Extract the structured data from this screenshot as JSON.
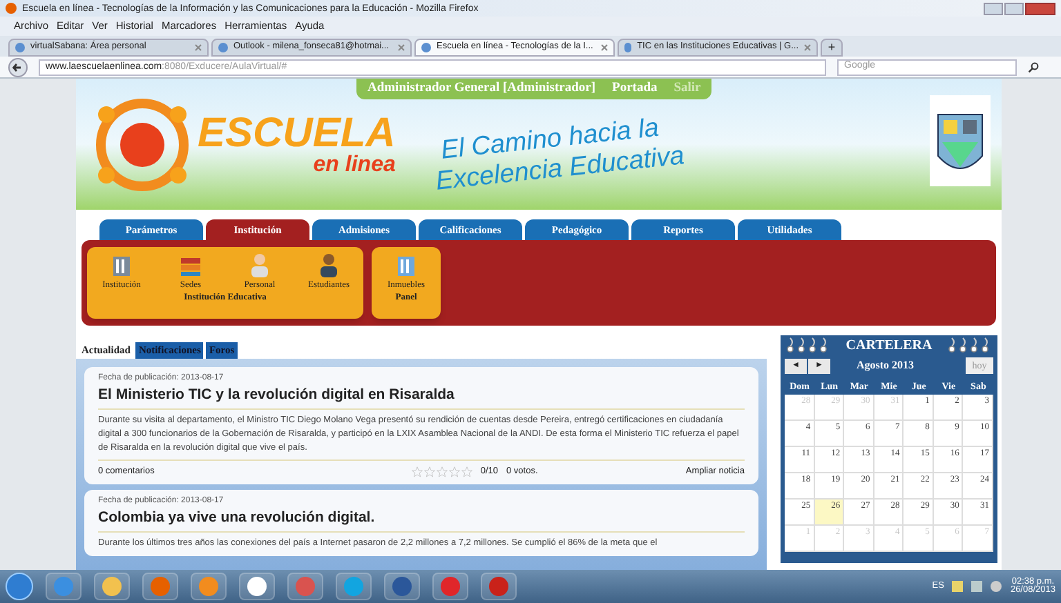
{
  "window": {
    "title": "Escuela en línea - Tecnologías de la Información y las Comunicaciones para la Educación - Mozilla Firefox"
  },
  "menu": [
    "Archivo",
    "Editar",
    "Ver",
    "Historial",
    "Marcadores",
    "Herramientas",
    "Ayuda"
  ],
  "browser_tabs": [
    {
      "label": "virtualSabana: Área personal",
      "selected": false
    },
    {
      "label": "Outlook - milena_fonseca81@hotmai...",
      "selected": false
    },
    {
      "label": "Escuela en línea - Tecnologías de la I...",
      "selected": true
    },
    {
      "label": "TIC en las Instituciones Educativas | G...",
      "selected": false
    }
  ],
  "new_tab": "+",
  "address": {
    "host": "www.laescuelaenlinea.com",
    "path": ":8080/Exducere/AulaVirtual/#"
  },
  "search": {
    "placeholder": "Google"
  },
  "header": {
    "user": "Administrador General [Administrador]",
    "links": [
      {
        "label": "Portada",
        "disabled": false
      },
      {
        "label": "Salir",
        "disabled": true
      }
    ],
    "logo_title": "ESCUELA",
    "logo_subtitle": "en linea",
    "slogan": [
      "El Camino hacia la",
      "Excelencia Educativa"
    ]
  },
  "nav_tabs": [
    {
      "label": "Parámetros",
      "selected": false
    },
    {
      "label": "Institución",
      "selected": true
    },
    {
      "label": "Admisiones",
      "selected": false
    },
    {
      "label": "Calificaciones",
      "selected": false
    },
    {
      "label": "Pedagógico",
      "selected": false
    },
    {
      "label": "Reportes",
      "selected": false
    },
    {
      "label": "Utilidades",
      "selected": false
    }
  ],
  "submenu_groups": [
    {
      "label": "Institución Educativa",
      "items": [
        "Institución",
        "Sedes",
        "Personal",
        "Estudiantes"
      ]
    },
    {
      "label": "Panel",
      "items": [
        "Inmuebles"
      ]
    }
  ],
  "content_tabs": [
    {
      "label": "Actualidad",
      "selected": true
    },
    {
      "label": "Notificaciones",
      "selected": false
    },
    {
      "label": "Foros",
      "selected": false
    }
  ],
  "news": [
    {
      "date": "Fecha de publicación: 2013-08-17",
      "title": "El Ministerio TIC y la revolución digital en Risaralda",
      "body": "Durante su visita al departamento, el Ministro TIC Diego Molano Vega presentó su rendición de cuentas desde Pereira, entregó certificaciones en ciudadanía digital a 300 funcionarios de la Gobernación de Risaralda, y participó en la LXIX Asamblea Nacional de la ANDI. De esta forma el Ministerio TIC refuerza el papel de Risaralda en la revolución digital que vive el país.",
      "comments": "0 comentarios",
      "stars": 0,
      "score": "0/10",
      "votes": "0 votos.",
      "more": "Ampliar noticia"
    },
    {
      "date": "Fecha de publicación: 2013-08-17",
      "title": "Colombia ya vive una revolución digital.",
      "body": "Durante los últimos tres años las conexiones del país a Internet pasaron de 2,2 millones a 7,2 millones. Se cumplió el 86% de la meta que el"
    }
  ],
  "calendar": {
    "title": "CARTELERA",
    "month": "Agosto 2013",
    "prev": "◄",
    "next": "►",
    "today": "hoy",
    "weekdays": [
      "Dom",
      "Lun",
      "Mar",
      "Mie",
      "Jue",
      "Vie",
      "Sab"
    ],
    "weeks": [
      [
        {
          "day": "28",
          "other": true,
          "selected": false
        },
        {
          "day": "29",
          "other": true,
          "selected": false
        },
        {
          "day": "30",
          "other": true,
          "selected": false
        },
        {
          "day": "31",
          "other": true,
          "selected": false
        },
        {
          "day": "1",
          "other": false,
          "selected": false
        },
        {
          "day": "2",
          "other": false,
          "selected": false
        },
        {
          "day": "3",
          "other": false,
          "selected": false
        }
      ],
      [
        {
          "day": "4",
          "other": false,
          "selected": false
        },
        {
          "day": "5",
          "other": false,
          "selected": false
        },
        {
          "day": "6",
          "other": false,
          "selected": false
        },
        {
          "day": "7",
          "other": false,
          "selected": false
        },
        {
          "day": "8",
          "other": false,
          "selected": false
        },
        {
          "day": "9",
          "other": false,
          "selected": false
        },
        {
          "day": "10",
          "other": false,
          "selected": false
        }
      ],
      [
        {
          "day": "11",
          "other": false,
          "selected": false
        },
        {
          "day": "12",
          "other": false,
          "selected": false
        },
        {
          "day": "13",
          "other": false,
          "selected": false
        },
        {
          "day": "14",
          "other": false,
          "selected": false
        },
        {
          "day": "15",
          "other": false,
          "selected": false
        },
        {
          "day": "16",
          "other": false,
          "selected": false
        },
        {
          "day": "17",
          "other": false,
          "selected": false
        }
      ],
      [
        {
          "day": "18",
          "other": false,
          "selected": false
        },
        {
          "day": "19",
          "other": false,
          "selected": false
        },
        {
          "day": "20",
          "other": false,
          "selected": false
        },
        {
          "day": "21",
          "other": false,
          "selected": false
        },
        {
          "day": "22",
          "other": false,
          "selected": false
        },
        {
          "day": "23",
          "other": false,
          "selected": false
        },
        {
          "day": "24",
          "other": false,
          "selected": false
        }
      ],
      [
        {
          "day": "25",
          "other": false,
          "selected": false
        },
        {
          "day": "26",
          "other": false,
          "selected": true
        },
        {
          "day": "27",
          "other": false,
          "selected": false
        },
        {
          "day": "28",
          "other": false,
          "selected": false
        },
        {
          "day": "29",
          "other": false,
          "selected": false
        },
        {
          "day": "30",
          "other": false,
          "selected": false
        },
        {
          "day": "31",
          "other": false,
          "selected": false
        }
      ],
      [
        {
          "day": "1",
          "other": true,
          "selected": false
        },
        {
          "day": "2",
          "other": true,
          "selected": false
        },
        {
          "day": "3",
          "other": true,
          "selected": false
        },
        {
          "day": "4",
          "other": true,
          "selected": false
        },
        {
          "day": "5",
          "other": true,
          "selected": false
        },
        {
          "day": "6",
          "other": true,
          "selected": false
        },
        {
          "day": "7",
          "other": true,
          "selected": false
        }
      ]
    ]
  },
  "taskbar": {
    "language": "ES",
    "time": "02:38 p.m.",
    "date": "26/08/2013"
  }
}
